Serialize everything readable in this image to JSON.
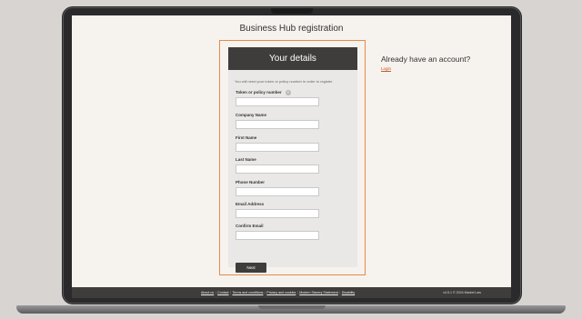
{
  "page": {
    "title": "Business Hub registration"
  },
  "form": {
    "header": "Your details",
    "intro": "You will need your token or policy number in order to register",
    "fields": [
      {
        "label": "Token or policy number",
        "value": ""
      },
      {
        "label": "Company Name",
        "value": ""
      },
      {
        "label": "First Name",
        "value": ""
      },
      {
        "label": "Last Name",
        "value": ""
      },
      {
        "label": "Phone Number",
        "value": ""
      },
      {
        "label": "Email Address",
        "value": ""
      },
      {
        "label": "Confirm Email",
        "value": ""
      }
    ],
    "help_glyph": "?",
    "next_label": "Next"
  },
  "account": {
    "heading": "Already have an account?",
    "login_label": "Login"
  },
  "footer": {
    "links": [
      "About us",
      "Contact",
      "Terms and conditions",
      "Privacy and cookies",
      "Modern Slavery Statement",
      "Disability"
    ],
    "separator": "|",
    "version": "v4.5.1 © 2024 Markel Law"
  },
  "colors": {
    "accent": "#e58a4a",
    "dark": "#3e3d3c",
    "link": "#c05a2a"
  }
}
